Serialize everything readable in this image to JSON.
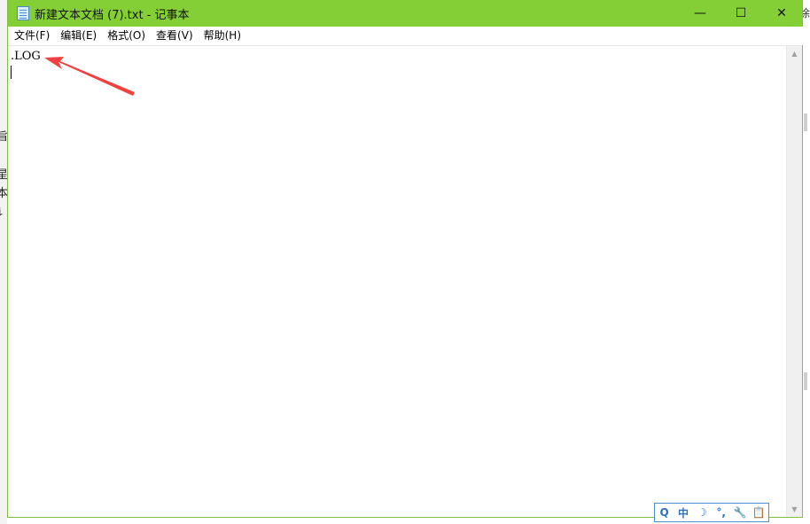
{
  "window": {
    "title": "新建文本文档 (7).txt - 记事本",
    "controls": {
      "minimize": "—",
      "maximize": "☐",
      "close": "✕"
    }
  },
  "menu": {
    "items": [
      {
        "label": "文件(F)"
      },
      {
        "label": "编辑(E)"
      },
      {
        "label": "格式(O)"
      },
      {
        "label": "查看(V)"
      },
      {
        "label": "帮助(H)"
      }
    ]
  },
  "editor": {
    "content": ".LOG"
  },
  "background": {
    "left_chars": [
      "旨",
      "星",
      "本",
      "讠"
    ],
    "right_text": "徐"
  },
  "ime": {
    "items": [
      "Q",
      "中",
      "☽",
      "°,",
      "🔧",
      "📋"
    ]
  },
  "colors": {
    "titlebar": "#84cf36",
    "annotation_arrow": "#f04040",
    "ime_accent": "#2d6fc2"
  }
}
